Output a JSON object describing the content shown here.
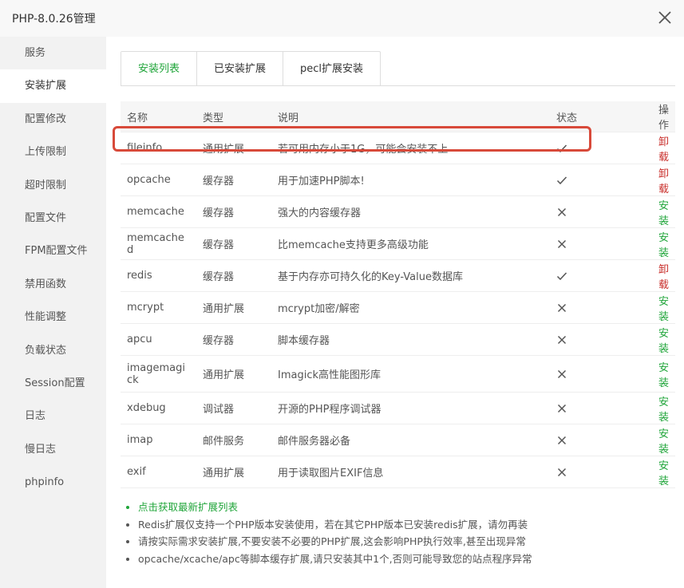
{
  "window": {
    "title": "PHP-8.0.26管理"
  },
  "sidebar": {
    "items": [
      {
        "label": "服务"
      },
      {
        "label": "安装扩展"
      },
      {
        "label": "配置修改"
      },
      {
        "label": "上传限制"
      },
      {
        "label": "超时限制"
      },
      {
        "label": "配置文件"
      },
      {
        "label": "FPM配置文件"
      },
      {
        "label": "禁用函数"
      },
      {
        "label": "性能调整"
      },
      {
        "label": "负载状态"
      },
      {
        "label": "Session配置"
      },
      {
        "label": "日志"
      },
      {
        "label": "慢日志"
      },
      {
        "label": "phpinfo"
      }
    ],
    "active_index": 1
  },
  "tabs": [
    {
      "label": "安装列表"
    },
    {
      "label": "已安装扩展"
    },
    {
      "label": "pecl扩展安装"
    }
  ],
  "table": {
    "headers": {
      "name": "名称",
      "type": "类型",
      "desc": "说明",
      "state": "状态",
      "op": "操作"
    },
    "rows": [
      {
        "name": "fileinfo",
        "type": "通用扩展",
        "desc": "若可用内存小于1G，可能会安装不上",
        "installed": true,
        "op": "卸载"
      },
      {
        "name": "opcache",
        "type": "缓存器",
        "desc": "用于加速PHP脚本!",
        "installed": true,
        "op": "卸载"
      },
      {
        "name": "memcache",
        "type": "缓存器",
        "desc": "强大的内容缓存器",
        "installed": false,
        "op": "安装"
      },
      {
        "name": "memcached",
        "type": "缓存器",
        "desc": "比memcache支持更多高级功能",
        "installed": false,
        "op": "安装"
      },
      {
        "name": "redis",
        "type": "缓存器",
        "desc": "基于内存亦可持久化的Key-Value数据库",
        "installed": true,
        "op": "卸载"
      },
      {
        "name": "mcrypt",
        "type": "通用扩展",
        "desc": "mcrypt加密/解密",
        "installed": false,
        "op": "安装"
      },
      {
        "name": "apcu",
        "type": "缓存器",
        "desc": "脚本缓存器",
        "installed": false,
        "op": "安装"
      },
      {
        "name": "imagemagick",
        "type": "通用扩展",
        "desc": "Imagick高性能图形库",
        "installed": false,
        "op": "安装"
      },
      {
        "name": "xdebug",
        "type": "调试器",
        "desc": "开源的PHP程序调试器",
        "installed": false,
        "op": "安装"
      },
      {
        "name": "imap",
        "type": "邮件服务",
        "desc": "邮件服务器必备",
        "installed": false,
        "op": "安装"
      },
      {
        "name": "exif",
        "type": "通用扩展",
        "desc": "用于读取图片EXIF信息",
        "installed": false,
        "op": "安装"
      }
    ]
  },
  "tips": [
    {
      "text": "点击获取最新扩展列表",
      "link": true
    },
    {
      "text": "Redis扩展仅支持一个PHP版本安装使用，若在其它PHP版本已安装redis扩展，请勿再装",
      "link": false
    },
    {
      "text": "请按实际需求安装扩展,不要安装不必要的PHP扩展,这会影响PHP执行效率,甚至出现异常",
      "link": false
    },
    {
      "text": "opcache/xcache/apc等脚本缓存扩展,请只安装其中1个,否则可能导致您的站点程序异常",
      "link": false
    }
  ],
  "colors": {
    "accent": "#20a53a",
    "danger": "#c9302c",
    "highlight": "#d84a3a"
  },
  "icons": {
    "installed": "check-icon",
    "not_installed": "cross-icon",
    "close": "close-icon"
  }
}
